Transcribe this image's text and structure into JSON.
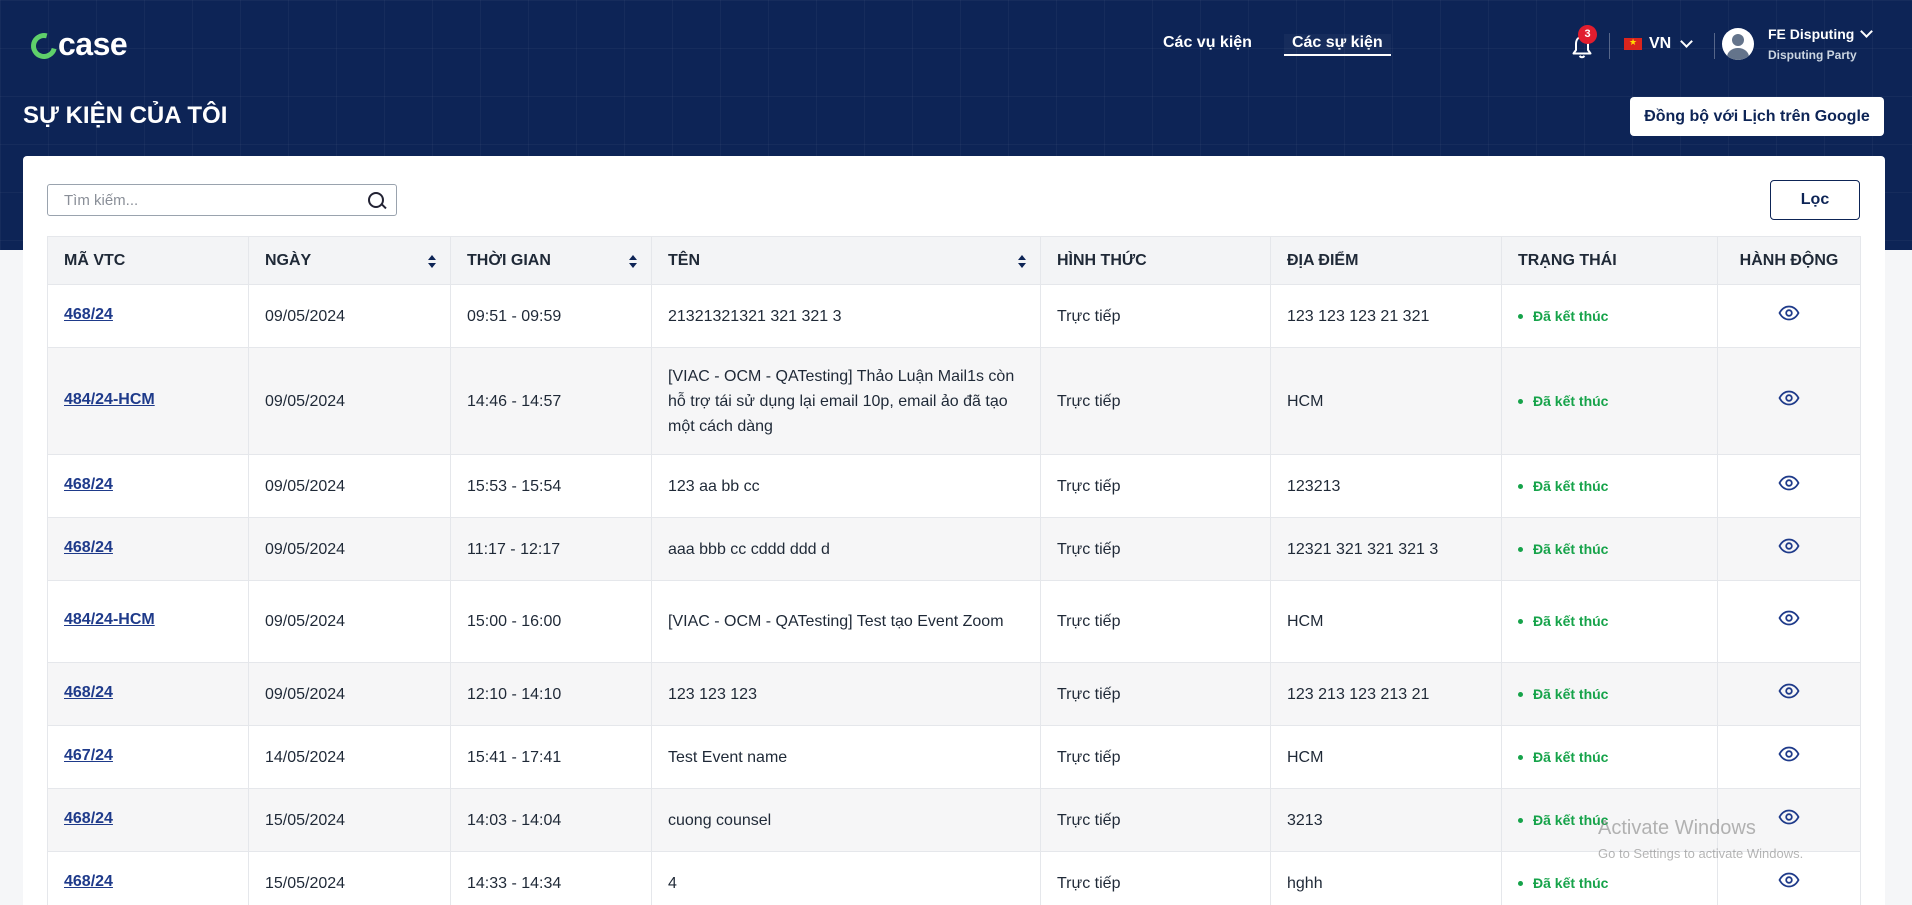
{
  "brand": {
    "logo_text": "case"
  },
  "nav": {
    "items": [
      {
        "label": "Các vụ kiện"
      },
      {
        "label": "Các sự kiện"
      }
    ]
  },
  "notifications": {
    "count": "3"
  },
  "language": {
    "code": "VN"
  },
  "user": {
    "name": "FE Disputing",
    "role": "Disputing Party"
  },
  "page": {
    "title": "SỰ KIỆN CỦA TÔI",
    "sync_label": "Đồng bộ với Lịch trên Google"
  },
  "search": {
    "placeholder": "Tìm kiếm..."
  },
  "filter": {
    "label": "Lọc"
  },
  "table": {
    "columns": [
      "MÃ VTC",
      "NGÀY",
      "THỜI GIAN",
      "TÊN",
      "HÌNH THỨC",
      "ĐỊA ĐIỂM",
      "TRẠNG THÁI",
      "HÀNH ĐỘNG"
    ],
    "rows": [
      {
        "code": "468/24",
        "date": "09/05/2024",
        "time": "09:51 - 09:59",
        "name": "21321321321 321 321 3",
        "mode": "Trực tiếp",
        "location": "123 123 123 21 321",
        "status": "Đã kết thúc"
      },
      {
        "code": "484/24-HCM",
        "date": "09/05/2024",
        "time": "14:46 - 14:57",
        "name": "[VIAC - OCM - QATesting] Thảo Luận Mail1s còn hỗ trợ tái sử dụng lại email 10p, email ảo đã tạo một cách dàng",
        "mode": "Trực tiếp",
        "location": "HCM",
        "status": "Đã kết thúc"
      },
      {
        "code": "468/24",
        "date": "09/05/2024",
        "time": "15:53 - 15:54",
        "name": "123 aa bb cc",
        "mode": "Trực tiếp",
        "location": "123213",
        "status": "Đã kết thúc"
      },
      {
        "code": "468/24",
        "date": "09/05/2024",
        "time": "11:17 - 12:17",
        "name": "aaa bbb cc cddd ddd d",
        "mode": "Trực tiếp",
        "location": "12321 321 321 321 3",
        "status": "Đã kết thúc"
      },
      {
        "code": "484/24-HCM",
        "date": "09/05/2024",
        "time": "15:00 - 16:00",
        "name": "[VIAC - OCM - QATesting] Test tạo Event Zoom",
        "mode": "Trực tiếp",
        "location": "HCM",
        "status": "Đã kết thúc"
      },
      {
        "code": "468/24",
        "date": "09/05/2024",
        "time": "12:10 - 14:10",
        "name": "123 123 123",
        "mode": "Trực tiếp",
        "location": "123 213 123 213 21",
        "status": "Đã kết thúc"
      },
      {
        "code": "467/24",
        "date": "14/05/2024",
        "time": "15:41 - 17:41",
        "name": "Test Event name",
        "mode": "Trực tiếp",
        "location": "HCM",
        "status": "Đã kết thúc"
      },
      {
        "code": "468/24",
        "date": "15/05/2024",
        "time": "14:03 - 14:04",
        "name": "cuong counsel",
        "mode": "Trực tiếp",
        "location": "3213",
        "status": "Đã kết thúc"
      },
      {
        "code": "468/24",
        "date": "15/05/2024",
        "time": "14:33 - 14:34",
        "name": "4",
        "mode": "Trực tiếp",
        "location": "hghh",
        "status": "Đã kết thúc"
      }
    ]
  },
  "watermark": {
    "title": "Activate Windows",
    "subtitle": "Go to Settings to activate Windows."
  },
  "colors": {
    "header_bg": "#0d2456",
    "status_green": "#16a34a",
    "link_blue": "#1e3a8a",
    "badge_red": "#e11d2e"
  }
}
